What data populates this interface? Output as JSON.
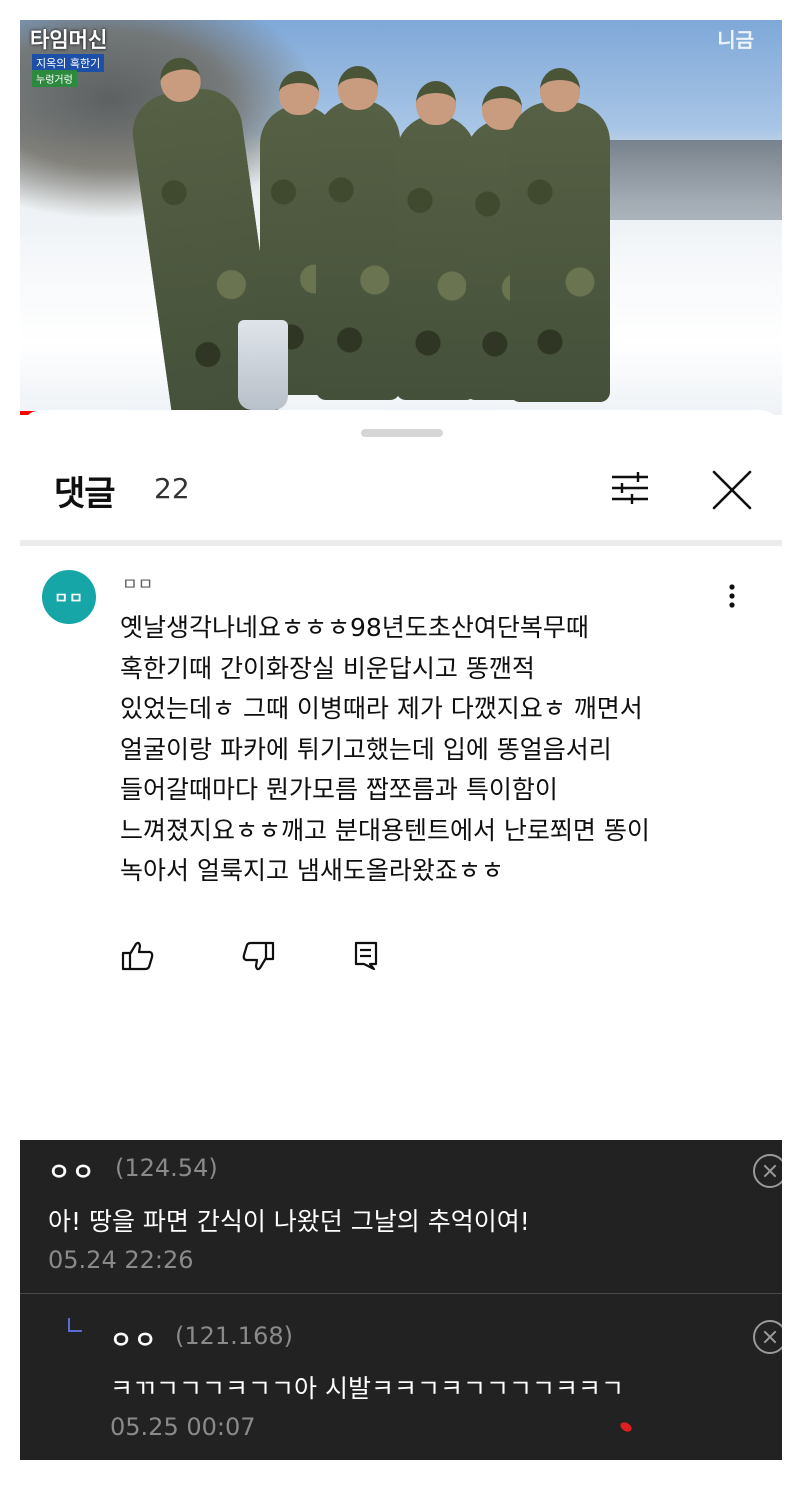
{
  "video": {
    "logo": "타임머신",
    "tag": "지옥의 혹한기",
    "tag2": "누렁거렁",
    "channel_mark": "니금"
  },
  "header": {
    "title": "댓글",
    "count": "22"
  },
  "comment": {
    "avatar_text": "ㅁㅁ",
    "author": "ㅁㅁ",
    "lines": [
      "옛날생각나네요ㅎㅎㅎ98년도초산여단복무때",
      "혹한기때 간이화장실 비운답시고 똥깬적",
      "있었는데ㅎ 그때 이병때라 제가 다깼지요ㅎ 깨면서",
      "얼굴이랑 파카에 튀기고했는데 입에 똥얼음서리",
      "들어갈때마다 뭔가모름 짭쪼름과 특이함이",
      "느껴졌지요ㅎㅎ깨고 분대용텐트에서 난로쬐면 똥이",
      "녹아서 얼룩지고 냄새도올라왔죠ㅎㅎ"
    ]
  },
  "replies": [
    {
      "name": "ㅇㅇ",
      "score": "(124.54)",
      "text": "아! 땅을 파면 간식이 나왔던 그날의 추억이여!",
      "time": "05.24 22:26"
    },
    {
      "name": "ㅇㅇ",
      "score": "(121.168)",
      "text": "ㅋㄲㄱㄱㄱㅋㄱㄱ아 시발ㅋㅋㄱㅋㄱㄱㄱㄱㅋㅋㄱ",
      "time": "05.25 00:07"
    }
  ]
}
